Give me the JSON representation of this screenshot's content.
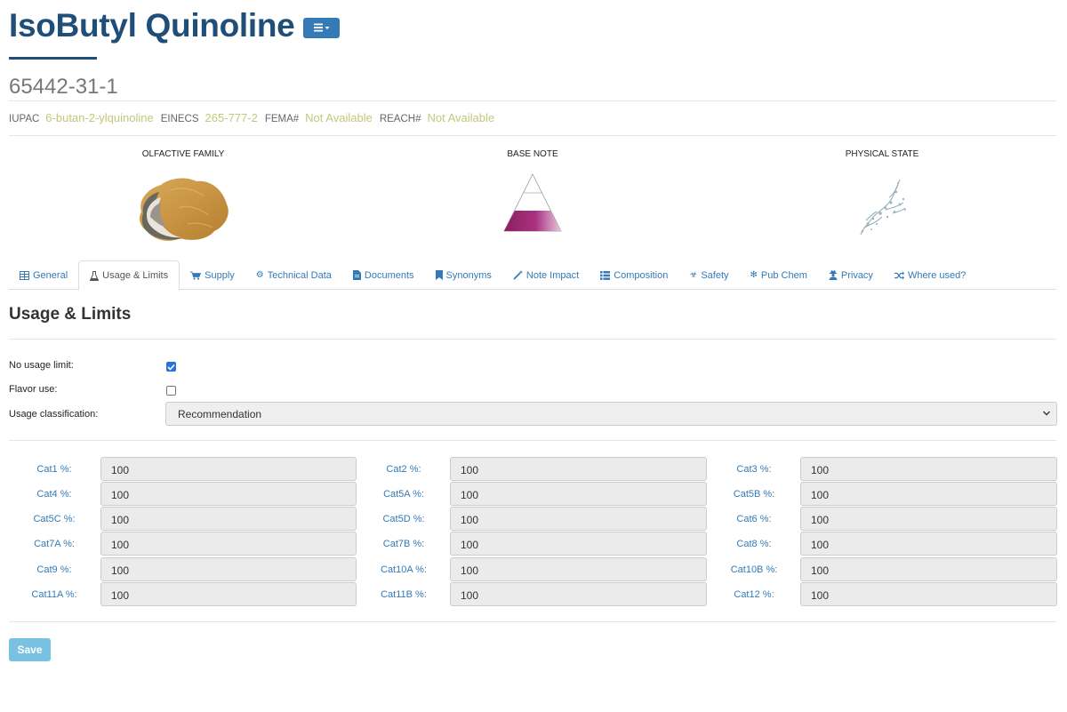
{
  "header": {
    "title": "IsoButyl Quinoline",
    "cas": "65442-31-1",
    "menu_icon": "bars-dropdown-icon"
  },
  "identifiers": [
    {
      "label": "IUPAC",
      "value": "6-butan-2-ylquinoline"
    },
    {
      "label": "EINECS",
      "value": "265-777-2"
    },
    {
      "label": "FEMA#",
      "value": "Not Available"
    },
    {
      "label": "REACH#",
      "value": "Not Available"
    }
  ],
  "cards": {
    "olfactive": {
      "title": "OLFACTIVE FAMILY"
    },
    "note": {
      "title": "BASE NOTE"
    },
    "state": {
      "title": "PHYSICAL STATE"
    }
  },
  "tabs": [
    {
      "label": "General",
      "icon": "table-icon"
    },
    {
      "label": "Usage & Limits",
      "icon": "flask-icon"
    },
    {
      "label": "Supply",
      "icon": "cart-icon"
    },
    {
      "label": "Technical Data",
      "icon": "gear-icon"
    },
    {
      "label": "Documents",
      "icon": "file-icon"
    },
    {
      "label": "Synonyms",
      "icon": "bookmark-icon"
    },
    {
      "label": "Note Impact",
      "icon": "magic-icon"
    },
    {
      "label": "Composition",
      "icon": "list-icon"
    },
    {
      "label": "Safety",
      "icon": "biohazard-icon"
    },
    {
      "label": "Pub Chem",
      "icon": "atom-icon"
    },
    {
      "label": "Privacy",
      "icon": "user-secret-icon"
    },
    {
      "label": "Where used?",
      "icon": "shuffle-icon"
    }
  ],
  "section": {
    "title": "Usage & Limits",
    "no_usage_limit_label": "No usage limit:",
    "no_usage_limit_checked": true,
    "flavor_use_label": "Flavor use:",
    "flavor_use_checked": false,
    "usage_classification_label": "Usage classification:",
    "usage_classification_value": "Recommendation"
  },
  "categories": [
    {
      "label": "Cat1 %:",
      "value": "100"
    },
    {
      "label": "Cat2 %:",
      "value": "100"
    },
    {
      "label": "Cat3 %:",
      "value": "100"
    },
    {
      "label": "Cat4 %:",
      "value": "100"
    },
    {
      "label": "Cat5A %:",
      "value": "100"
    },
    {
      "label": "Cat5B %:",
      "value": "100"
    },
    {
      "label": "Cat5C %:",
      "value": "100"
    },
    {
      "label": "Cat5D %:",
      "value": "100"
    },
    {
      "label": "Cat6 %:",
      "value": "100"
    },
    {
      "label": "Cat7A %:",
      "value": "100"
    },
    {
      "label": "Cat7B %:",
      "value": "100"
    },
    {
      "label": "Cat8 %:",
      "value": "100"
    },
    {
      "label": "Cat9 %:",
      "value": "100"
    },
    {
      "label": "Cat10A %:",
      "value": "100"
    },
    {
      "label": "Cat10B %:",
      "value": "100"
    },
    {
      "label": "Cat11A %:",
      "value": "100"
    },
    {
      "label": "Cat11B %:",
      "value": "100"
    },
    {
      "label": "Cat12 %:",
      "value": "100"
    }
  ],
  "save_label": "Save",
  "colors": {
    "title": "#1f4e79",
    "link": "#337ab7",
    "identifier_value": "#c3c77a",
    "save_button": "#79c1e0",
    "pyramid_fill": "#a0256e"
  }
}
